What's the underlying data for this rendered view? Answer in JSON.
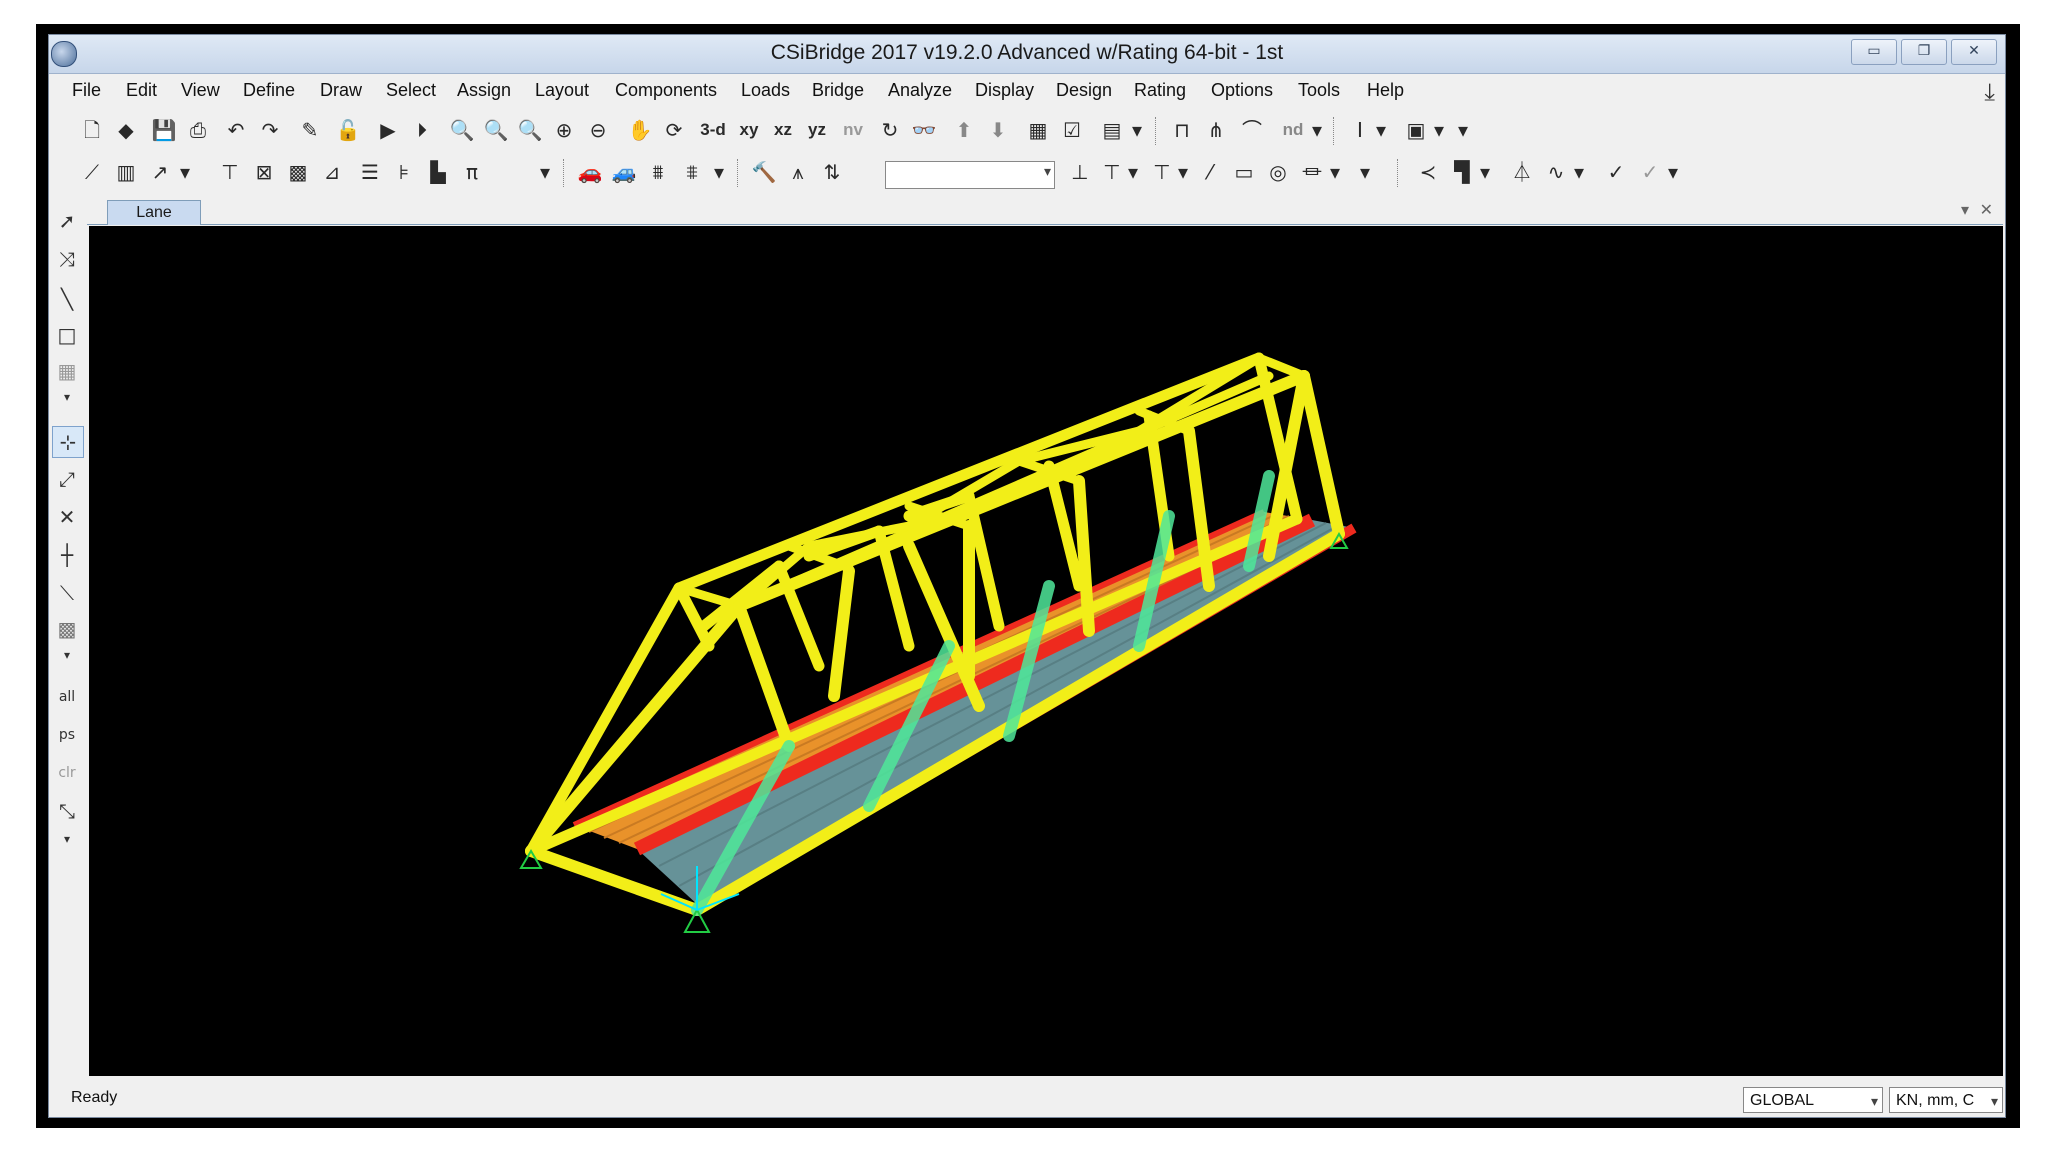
{
  "window": {
    "title": "CSiBridge 2017 v19.2.0 Advanced w/Rating 64-bit - 1st"
  },
  "menu": [
    "File",
    "Edit",
    "View",
    "Define",
    "Draw",
    "Select",
    "Assign",
    "Layout",
    "Components",
    "Loads",
    "Bridge",
    "Analyze",
    "Display",
    "Design",
    "Rating",
    "Options",
    "Tools",
    "Help"
  ],
  "toolbar": {
    "view_3d": "3-d",
    "view_xy": "xy",
    "view_xz": "xz",
    "view_yz": "yz",
    "view_nv": "nv",
    "nd": "nd"
  },
  "tabs": [
    {
      "label": "Lane"
    }
  ],
  "status": {
    "text": "Ready"
  },
  "coord_system": {
    "selected": "GLOBAL"
  },
  "units": {
    "selected": "KN, mm, C"
  },
  "colors": {
    "background": "#000000",
    "truss": "#f2ee18",
    "deck_orange": "#f59a2c",
    "deck_grey": "#6b9aa0",
    "edge_red": "#ee2a1e",
    "diagonal_green": "#4fe89a"
  }
}
